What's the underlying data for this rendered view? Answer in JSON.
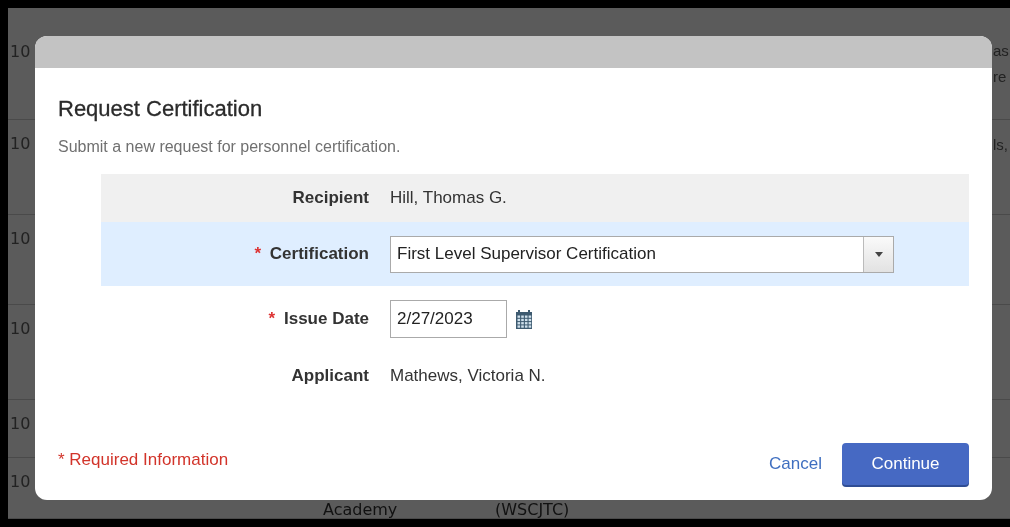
{
  "background_table": {
    "rows": [
      {
        "column_1": "10",
        "column_4": [
          "as",
          "re"
        ]
      },
      {
        "column_1": "10",
        "column_4": [
          "ls,"
        ]
      },
      {
        "column_1": "10"
      },
      {
        "column_1": "10"
      },
      {
        "column_1": "10"
      },
      {
        "column_1": "10",
        "column_2": "Academy",
        "column_3": "(WSCJTC)"
      }
    ]
  },
  "dialog": {
    "title": "Request Certification",
    "subtitle": "Submit a new request for personnel certification.",
    "fields": [
      {
        "kind": "text",
        "label": "Recipient",
        "value": "Hill, Thomas G.",
        "shaded": true,
        "selected": false
      },
      {
        "kind": "select",
        "label": "Certification",
        "required_mark": "*",
        "value": "First Level Supervisor Certification",
        "shaded": false,
        "selected": true
      },
      {
        "kind": "date",
        "label": "Issue Date",
        "required_mark": "*",
        "value": "2/27/2023",
        "shaded": false,
        "selected": false
      },
      {
        "kind": "text",
        "label": "Applicant",
        "value": "Mathews, Victoria N.",
        "shaded": false,
        "selected": false
      }
    ],
    "required_note": "* Required Information",
    "buttons": [
      {
        "kind": "link",
        "label": "Cancel"
      },
      {
        "kind": "primary",
        "label": "Continue"
      }
    ]
  }
}
